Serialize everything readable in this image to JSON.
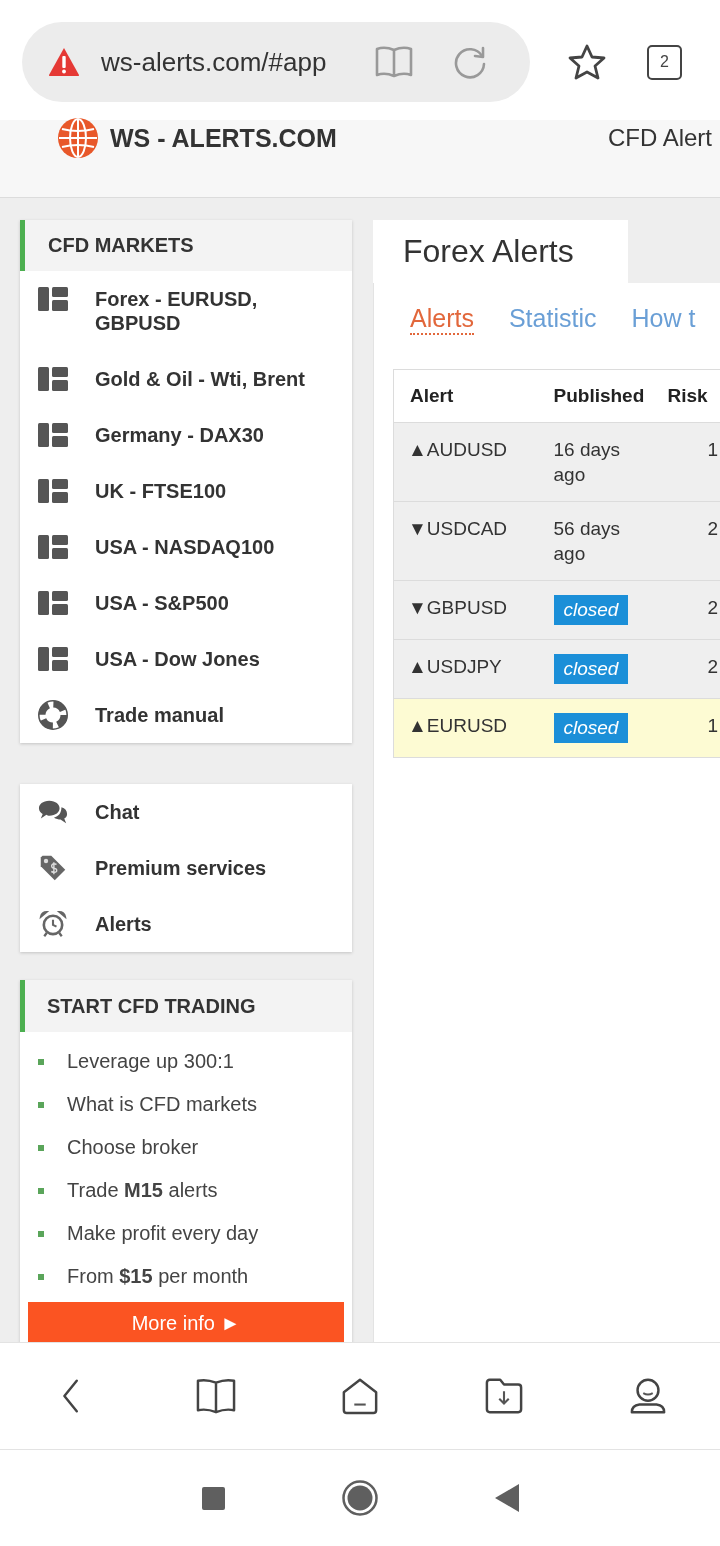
{
  "browser": {
    "url": "ws-alerts.com/#app",
    "tab_count": "2"
  },
  "site_header": {
    "logo_text": "WS - ALERTS.COM",
    "nav_link": "CFD Alert"
  },
  "sidebar": {
    "markets": {
      "title": "CFD MARKETS",
      "items": [
        {
          "label": "Forex - EURUSD, GBPUSD",
          "kind": "layout"
        },
        {
          "label": "Gold & Oil - Wti, Brent",
          "kind": "layout"
        },
        {
          "label": "Germany - DAX30",
          "kind": "layout"
        },
        {
          "label": "UK - FTSE100",
          "kind": "layout"
        },
        {
          "label": "USA - NASDAQ100",
          "kind": "layout"
        },
        {
          "label": "USA - S&P500",
          "kind": "layout"
        },
        {
          "label": "USA - Dow Jones",
          "kind": "layout"
        },
        {
          "label": "Trade manual",
          "kind": "lifebuoy"
        }
      ]
    },
    "links": [
      {
        "label": "Chat",
        "kind": "chat"
      },
      {
        "label": "Premium services",
        "kind": "tag"
      },
      {
        "label": "Alerts",
        "kind": "alarm"
      }
    ],
    "start": {
      "title": "START CFD TRADING",
      "items": [
        "Leverage up 300:1",
        "What is CFD markets",
        "Choose broker",
        "Trade **M15** alerts",
        "Make profit every day",
        "From **$15** per month"
      ],
      "button": "More info ►"
    }
  },
  "main": {
    "title": "Forex Alerts",
    "tabs": [
      {
        "label": "Alerts",
        "selected": true
      },
      {
        "label": "Statistic",
        "selected": false
      },
      {
        "label": "How t",
        "selected": false
      }
    ],
    "table": {
      "columns": [
        "Alert",
        "Published",
        "Risk"
      ],
      "rows": [
        {
          "alert": "▲AUDUSD",
          "published": {
            "kind": "text",
            "text": "16 days ago"
          },
          "risk": "1",
          "selected": false
        },
        {
          "alert": "▼USDCAD",
          "published": {
            "kind": "text",
            "text": "56 days ago"
          },
          "risk": "2",
          "selected": false
        },
        {
          "alert": "▼GBPUSD",
          "published": {
            "kind": "badge",
            "text": "closed"
          },
          "risk": "2",
          "selected": false
        },
        {
          "alert": "▲USDJPY",
          "published": {
            "kind": "badge",
            "text": "closed"
          },
          "risk": "2",
          "selected": false
        },
        {
          "alert": "▲EURUSD",
          "published": {
            "kind": "badge",
            "text": "closed"
          },
          "risk": "1",
          "selected": true
        }
      ]
    }
  }
}
